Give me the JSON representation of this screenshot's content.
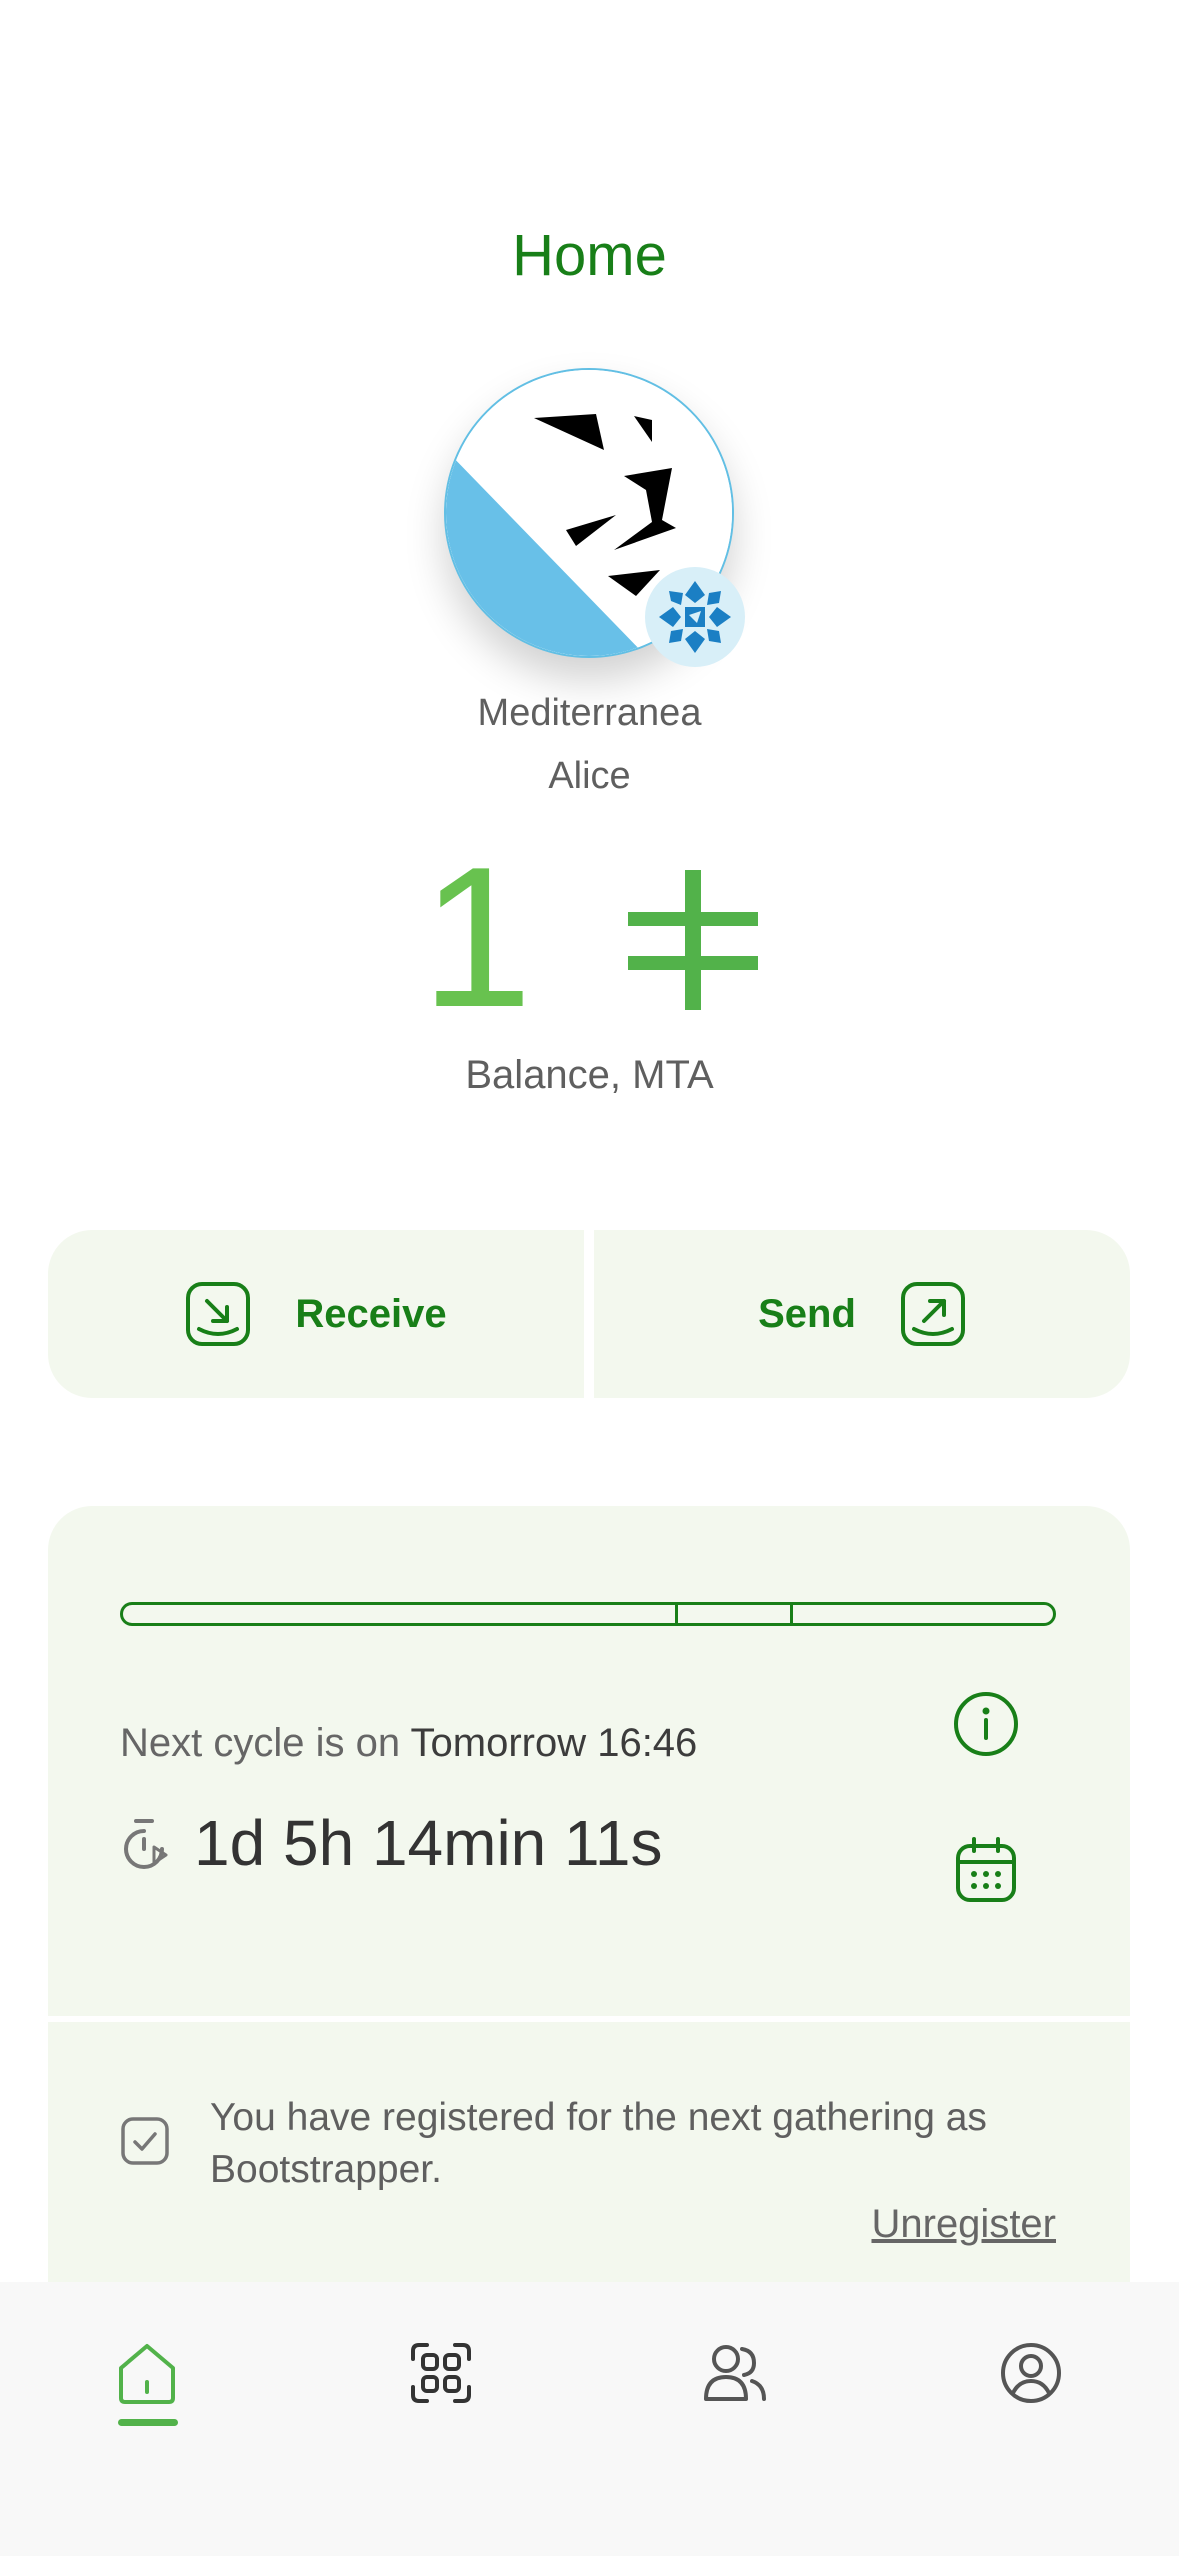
{
  "header": {
    "title": "Home"
  },
  "community": {
    "name": "Mediterranea",
    "user": "Alice",
    "avatar_icon": "lion-community-logo",
    "badge_icon": "community-seal-icon"
  },
  "balance": {
    "amount": "1",
    "currency_symbol": "⌿",
    "label": "Balance, MTA"
  },
  "actions": {
    "receive_label": "Receive",
    "send_label": "Send"
  },
  "cycle": {
    "prefix": "Next cycle is on",
    "time": "Tomorrow 16:46",
    "countdown": "1d 5h 14min 11s"
  },
  "meetup": {
    "message": "You have registered for the next gathering as Bootstrapper.",
    "unregister_label": "Unregister"
  },
  "nav": {
    "items": [
      "home-icon",
      "scan-qr-icon",
      "contacts-icon",
      "profile-icon"
    ],
    "active": "home-icon"
  },
  "colors": {
    "primary_dark_green": "#187f18",
    "accent_green": "#68c24f",
    "card_bg": "#f3f8ee",
    "avatar_blue": "#62bfe4"
  }
}
